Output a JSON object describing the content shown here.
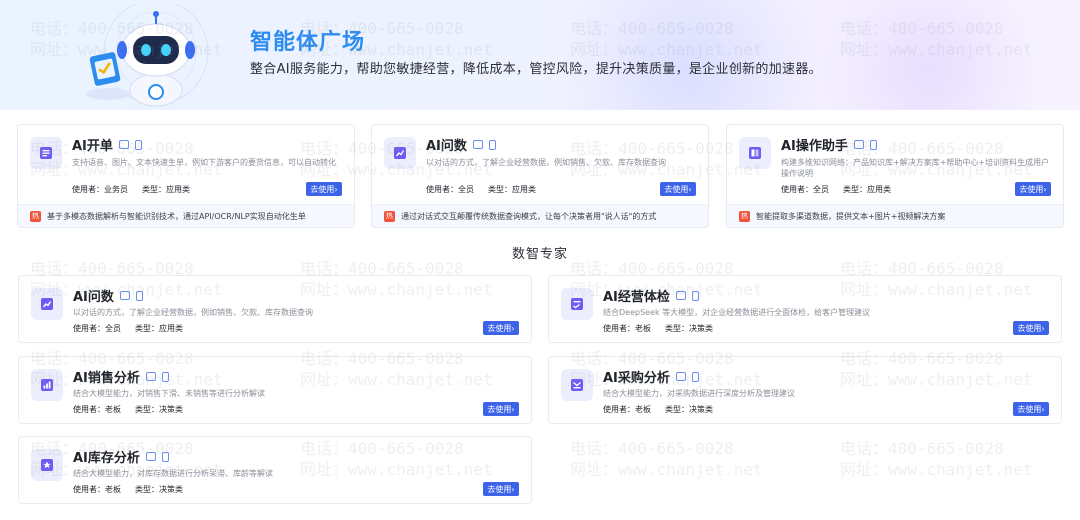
{
  "banner": {
    "title": "智能体广场",
    "subtitle": "整合AI服务能力，帮助您敏捷经营，降低成本，管控风险，提升决策质量，是企业创新的加速器。"
  },
  "top_cards": [
    {
      "title": "AI开单",
      "desc": "支持语音、图片、文本快速生单，例如下游客户的要货信息，可以自动转化",
      "user": "使用者：业务员",
      "type": "类型：应用类",
      "button": "去使用",
      "footer": "基于多模态数据解析与智能识别技术，通过API/OCR/NLP实现自动化生单",
      "icon": "document-list-icon"
    },
    {
      "title": "AI问数",
      "desc": "以对话的方式，了解企业经营数据，例如销售、欠款、库存数据查询",
      "user": "使用者：全员",
      "type": "类型：应用类",
      "button": "去使用",
      "footer": "通过对话式交互颠覆传统数据查询模式，让每个决策者用\"说人话\"的方式",
      "icon": "chart-doc-icon"
    },
    {
      "title": "AI操作助手",
      "desc": "构建多维知识网络：产品知识库+解决方案库+帮助中心+培训资料生成用户操作说明",
      "user": "使用者：全员",
      "type": "类型：应用类",
      "button": "去使用",
      "footer": "智能提取多渠道数据，提供文本+图片+视频解决方案",
      "icon": "book-icon"
    }
  ],
  "hot_badge": "热",
  "section": {
    "title": "数智专家"
  },
  "expert_cards": [
    {
      "title": "AI问数",
      "desc": "以对话的方式，了解企业经营数据，例如销售、欠款、库存数据查询",
      "user": "使用者：全员",
      "type": "类型：应用类",
      "button": "去使用",
      "icon": "chart-doc-icon"
    },
    {
      "title": "AI经营体检",
      "desc": "结合DeepSeek 等大模型，对企业经营数据进行全面体检，给客户管理建议",
      "user": "使用者：老板",
      "type": "类型：决策类",
      "button": "去使用",
      "icon": "checkup-icon"
    },
    {
      "title": "AI销售分析",
      "desc": "结合大模型能力，对销售下滑、未销售等进行分析解读",
      "user": "使用者：老板",
      "type": "类型：决策类",
      "button": "去使用",
      "icon": "sales-report-icon"
    },
    {
      "title": "AI采购分析",
      "desc": "结合大模型能力，对采购数据进行深度分析及管理建议",
      "user": "使用者：老板",
      "type": "类型：决策类",
      "button": "去使用",
      "icon": "purchase-icon"
    },
    {
      "title": "AI库存分析",
      "desc": "结合大模型能力，对库存数据进行分析呆滞、库龄等解读",
      "user": "使用者：老板",
      "type": "类型：决策类",
      "button": "去使用",
      "icon": "inventory-icon"
    }
  ],
  "watermark": {
    "line1": "电话：400-665-0028",
    "line2": "网址：www.chanjet.net"
  },
  "colors": {
    "accent": "#3c63e8",
    "title_blue": "#2d8cf0",
    "hot": "#f0553b"
  }
}
